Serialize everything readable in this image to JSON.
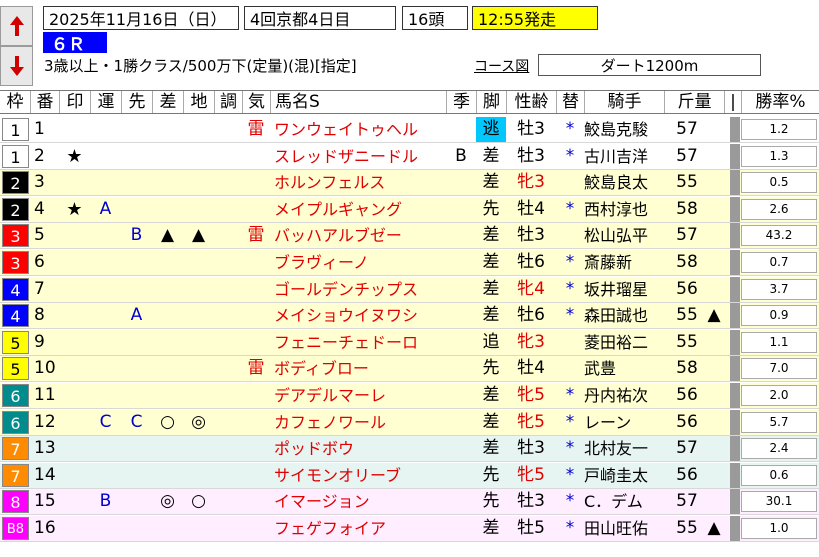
{
  "header": {
    "date": "2025年11月16日（日）",
    "meeting": "4回京都4日目",
    "head_count": "16頭",
    "start_time": "12:55発走",
    "race_number": "６Ｒ",
    "conditions": "3歳以上・1勝クラス/500万下(定量)(混)[指定]",
    "course_link": "コース図",
    "course": "ダート1200m"
  },
  "nav": {
    "up_icon": "arrow-up-icon",
    "down_icon": "arrow-down-icon"
  },
  "columns": [
    "枠",
    "番",
    "印",
    "運",
    "先",
    "差",
    "地",
    "調",
    "気",
    "馬名S",
    "季",
    "脚",
    "性齢",
    "替",
    "騎手",
    "斤量",
    "|",
    "勝率%"
  ],
  "colors": {
    "waku": [
      "#ffffff",
      "#000000",
      "#ff0000",
      "#0000ff",
      "#ffff00",
      "#008c8c",
      "#ff8c00",
      "#ff00ff"
    ],
    "row_bg": [
      "#ffffff",
      "#ffffd2",
      "#e6f4f2",
      "#ffeeff"
    ],
    "kyaku_highlight": "#00c8ff",
    "race_badge": "#0000ff",
    "start_time_bg": "#ffff00"
  },
  "horses": [
    {
      "waku": "1",
      "num": "1",
      "mark": "",
      "un": "",
      "saki": "",
      "sa": "",
      "chi": "",
      "cho": "",
      "ki": "雷",
      "name": "ワンウェイトゥヘル",
      "kisetsu": "",
      "kyaku": "逃",
      "seirei": "牡3",
      "seirei_red": false,
      "kae": "*",
      "jockey": "鮫島克駿",
      "kin": "57",
      "kin_mark": "",
      "odds": "1.2",
      "bg": 0,
      "hl": true
    },
    {
      "waku": "1",
      "num": "2",
      "mark": "★",
      "un": "",
      "saki": "",
      "sa": "",
      "chi": "",
      "cho": "",
      "ki": "",
      "name": "スレッドザニードル",
      "kisetsu": "B",
      "kyaku": "差",
      "seirei": "牡3",
      "seirei_red": false,
      "kae": "*",
      "jockey": "古川吉洋",
      "kin": "57",
      "kin_mark": "",
      "odds": "1.3",
      "bg": 0,
      "hl": false
    },
    {
      "waku": "2",
      "num": "3",
      "mark": "",
      "un": "",
      "saki": "",
      "sa": "",
      "chi": "",
      "cho": "",
      "ki": "",
      "name": "ホルンフェルス",
      "kisetsu": "",
      "kyaku": "差",
      "seirei": "牝3",
      "seirei_red": true,
      "kae": "",
      "jockey": "鮫島良太",
      "kin": "55",
      "kin_mark": "",
      "odds": "0.5",
      "bg": 1,
      "hl": false
    },
    {
      "waku": "2",
      "num": "4",
      "mark": "★",
      "un": "A",
      "saki": "",
      "sa": "",
      "chi": "",
      "cho": "",
      "ki": "",
      "name": "メイプルギャング",
      "kisetsu": "",
      "kyaku": "先",
      "seirei": "牡4",
      "seirei_red": false,
      "kae": "*",
      "jockey": "西村淳也",
      "kin": "58",
      "kin_mark": "",
      "odds": "2.6",
      "bg": 1,
      "hl": false
    },
    {
      "waku": "3",
      "num": "5",
      "mark": "",
      "un": "",
      "saki": "B",
      "sa": "▲",
      "chi": "▲",
      "cho": "",
      "ki": "雷",
      "name": "バッハアルブゼー",
      "kisetsu": "",
      "kyaku": "差",
      "seirei": "牡3",
      "seirei_red": false,
      "kae": "",
      "jockey": "松山弘平",
      "kin": "57",
      "kin_mark": "",
      "odds": "43.2",
      "bg": 1,
      "hl": false
    },
    {
      "waku": "3",
      "num": "6",
      "mark": "",
      "un": "",
      "saki": "",
      "sa": "",
      "chi": "",
      "cho": "",
      "ki": "",
      "name": "ブラヴィーノ",
      "kisetsu": "",
      "kyaku": "差",
      "seirei": "牡6",
      "seirei_red": false,
      "kae": "*",
      "jockey": "斎藤新",
      "kin": "58",
      "kin_mark": "",
      "odds": "0.7",
      "bg": 1,
      "hl": false
    },
    {
      "waku": "4",
      "num": "7",
      "mark": "",
      "un": "",
      "saki": "",
      "sa": "",
      "chi": "",
      "cho": "",
      "ki": "",
      "name": "ゴールデンチップス",
      "kisetsu": "",
      "kyaku": "差",
      "seirei": "牝4",
      "seirei_red": true,
      "kae": "*",
      "jockey": "坂井瑠星",
      "kin": "56",
      "kin_mark": "",
      "odds": "3.7",
      "bg": 1,
      "hl": false
    },
    {
      "waku": "4",
      "num": "8",
      "mark": "",
      "un": "",
      "saki": "A",
      "sa": "",
      "chi": "",
      "cho": "",
      "ki": "",
      "name": "メイショウイヌワシ",
      "kisetsu": "",
      "kyaku": "差",
      "seirei": "牡6",
      "seirei_red": false,
      "kae": "*",
      "jockey": "森田誠也",
      "kin": "55",
      "kin_mark": "▲",
      "odds": "0.9",
      "bg": 1,
      "hl": false
    },
    {
      "waku": "5",
      "num": "9",
      "mark": "",
      "un": "",
      "saki": "",
      "sa": "",
      "chi": "",
      "cho": "",
      "ki": "",
      "name": "フェニーチェドーロ",
      "kisetsu": "",
      "kyaku": "追",
      "seirei": "牝3",
      "seirei_red": true,
      "kae": "",
      "jockey": "菱田裕二",
      "kin": "55",
      "kin_mark": "",
      "odds": "1.1",
      "bg": 1,
      "hl": false
    },
    {
      "waku": "5",
      "num": "10",
      "mark": "",
      "un": "",
      "saki": "",
      "sa": "",
      "chi": "",
      "cho": "",
      "ki": "雷",
      "name": "ボディブロー",
      "kisetsu": "",
      "kyaku": "先",
      "seirei": "牡4",
      "seirei_red": false,
      "kae": "",
      "jockey": "武豊",
      "kin": "58",
      "kin_mark": "",
      "odds": "7.0",
      "bg": 1,
      "hl": false
    },
    {
      "waku": "6",
      "num": "11",
      "mark": "",
      "un": "",
      "saki": "",
      "sa": "",
      "chi": "",
      "cho": "",
      "ki": "",
      "name": "デアデルマーレ",
      "kisetsu": "",
      "kyaku": "差",
      "seirei": "牝5",
      "seirei_red": true,
      "kae": "*",
      "jockey": "丹内祐次",
      "kin": "56",
      "kin_mark": "",
      "odds": "2.0",
      "bg": 1,
      "hl": false
    },
    {
      "waku": "6",
      "num": "12",
      "mark": "",
      "un": "C",
      "saki": "C",
      "sa": "○",
      "chi": "◎",
      "cho": "",
      "ki": "",
      "name": "カフェノワール",
      "kisetsu": "",
      "kyaku": "差",
      "seirei": "牝5",
      "seirei_red": true,
      "kae": "*",
      "jockey": "レーン",
      "kin": "56",
      "kin_mark": "",
      "odds": "5.7",
      "bg": 1,
      "hl": false
    },
    {
      "waku": "7",
      "num": "13",
      "mark": "",
      "un": "",
      "saki": "",
      "sa": "",
      "chi": "",
      "cho": "",
      "ki": "",
      "name": "ポッドボウ",
      "kisetsu": "",
      "kyaku": "差",
      "seirei": "牡3",
      "seirei_red": false,
      "kae": "*",
      "jockey": "北村友一",
      "kin": "57",
      "kin_mark": "",
      "odds": "2.4",
      "bg": 2,
      "hl": false
    },
    {
      "waku": "7",
      "num": "14",
      "mark": "",
      "un": "",
      "saki": "",
      "sa": "",
      "chi": "",
      "cho": "",
      "ki": "",
      "name": "サイモンオリーブ",
      "kisetsu": "",
      "kyaku": "先",
      "seirei": "牝5",
      "seirei_red": true,
      "kae": "*",
      "jockey": "戸崎圭太",
      "kin": "56",
      "kin_mark": "",
      "odds": "0.6",
      "bg": 2,
      "hl": false
    },
    {
      "waku": "8",
      "num": "15",
      "mark": "",
      "un": "B",
      "saki": "",
      "sa": "◎",
      "chi": "○",
      "cho": "",
      "ki": "",
      "name": "イマージョン",
      "kisetsu": "",
      "kyaku": "先",
      "seirei": "牡3",
      "seirei_red": false,
      "kae": "*",
      "jockey": "C．デム",
      "kin": "57",
      "kin_mark": "",
      "odds": "30.1",
      "bg": 3,
      "hl": false
    },
    {
      "waku": "B8",
      "num": "16",
      "mark": "",
      "un": "",
      "saki": "",
      "sa": "",
      "chi": "",
      "cho": "",
      "ki": "",
      "name": "フェゲフォイア",
      "kisetsu": "",
      "kyaku": "差",
      "seirei": "牡5",
      "seirei_red": false,
      "kae": "*",
      "jockey": "田山旺佑",
      "kin": "55",
      "kin_mark": "▲",
      "odds": "1.0",
      "bg": 3,
      "hl": false
    }
  ]
}
